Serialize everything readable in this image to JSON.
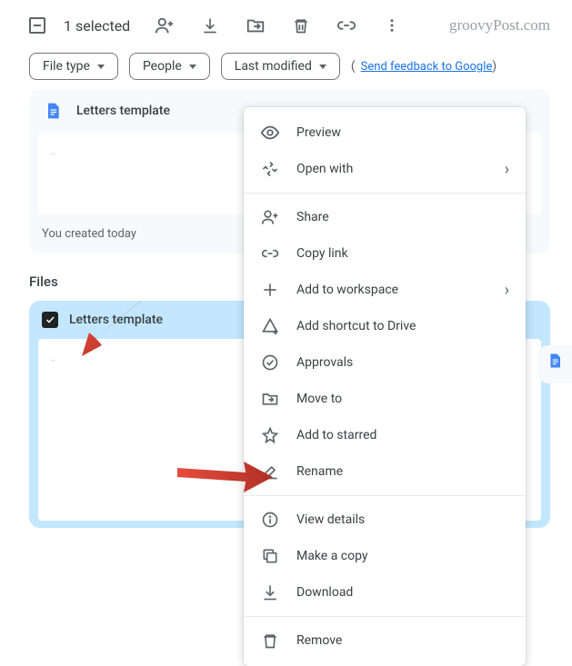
{
  "toolbar": {
    "selected_text": "1 selected"
  },
  "watermark": "groovyPost.com",
  "filters": {
    "file_type": "File type",
    "people": "People",
    "last_modified": "Last modified"
  },
  "feedback_link": "Send feedback to Google",
  "suggested_card": {
    "title": "Letters template",
    "caption": "You created today"
  },
  "section_title": "Files",
  "file_card": {
    "title": "Letters template"
  },
  "menu": {
    "preview": "Preview",
    "open_with": "Open with",
    "share": "Share",
    "copy_link": "Copy link",
    "add_to_workspace": "Add to workspace",
    "add_shortcut": "Add shortcut to Drive",
    "approvals": "Approvals",
    "move_to": "Move to",
    "add_to_starred": "Add to starred",
    "rename": "Rename",
    "view_details": "View details",
    "make_a_copy": "Make a copy",
    "download": "Download",
    "remove": "Remove"
  }
}
